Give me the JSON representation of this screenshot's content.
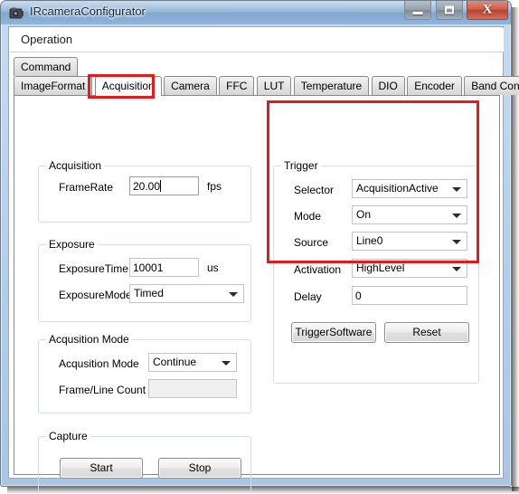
{
  "window": {
    "title": "IRcameraConfigurator",
    "icon": "camera-icon",
    "minimize_label": "Minimize",
    "maximize_label": "Maximize",
    "close_label": "X"
  },
  "menubar": {
    "items": [
      "Operation"
    ]
  },
  "tabs": {
    "row1": [
      {
        "label": "Command",
        "selected": false
      }
    ],
    "row2": [
      {
        "label": "ImageFormat",
        "selected": false
      },
      {
        "label": "Acquisition",
        "selected": true
      },
      {
        "label": "Camera",
        "selected": false
      },
      {
        "label": "FFC",
        "selected": false
      },
      {
        "label": "LUT",
        "selected": false
      },
      {
        "label": "Temperature",
        "selected": false
      },
      {
        "label": "DIO",
        "selected": false
      },
      {
        "label": "Encoder",
        "selected": false
      },
      {
        "label": "Band Control",
        "selected": false
      }
    ]
  },
  "acquisition_group": {
    "title": "Acquisition",
    "framerate_label": "FrameRate",
    "framerate_value": "20.00",
    "framerate_unit": "fps"
  },
  "exposure_group": {
    "title": "Exposure",
    "exposure_time_label": "ExposureTime",
    "exposure_time_value": "10001",
    "exposure_time_unit": "us",
    "exposure_mode_label": "ExposureMode",
    "exposure_mode_value": "Timed"
  },
  "acqusition_mode_group": {
    "title": "Acqusition Mode",
    "mode_label": "Acqusition Mode",
    "mode_value": "Continue",
    "frame_line_count_label": "Frame/Line Count",
    "frame_line_count_value": ""
  },
  "capture_group": {
    "title": "Capture",
    "start_label": "Start",
    "stop_label": "Stop"
  },
  "trigger_group": {
    "title": "Trigger",
    "selector_label": "Selector",
    "selector_value": "AcquisitionActive",
    "mode_label": "Mode",
    "mode_value": "On",
    "source_label": "Source",
    "source_value": "Line0",
    "activation_label": "Activation",
    "activation_value": "HighLevel",
    "delay_label": "Delay",
    "delay_value": "0",
    "trigger_software_label": "TriggerSoftware",
    "reset_label": "Reset"
  },
  "annotations": {
    "highlight_color": "#e8191b",
    "items": [
      "acquisition-tab-highlight",
      "trigger-group-highlight"
    ]
  }
}
